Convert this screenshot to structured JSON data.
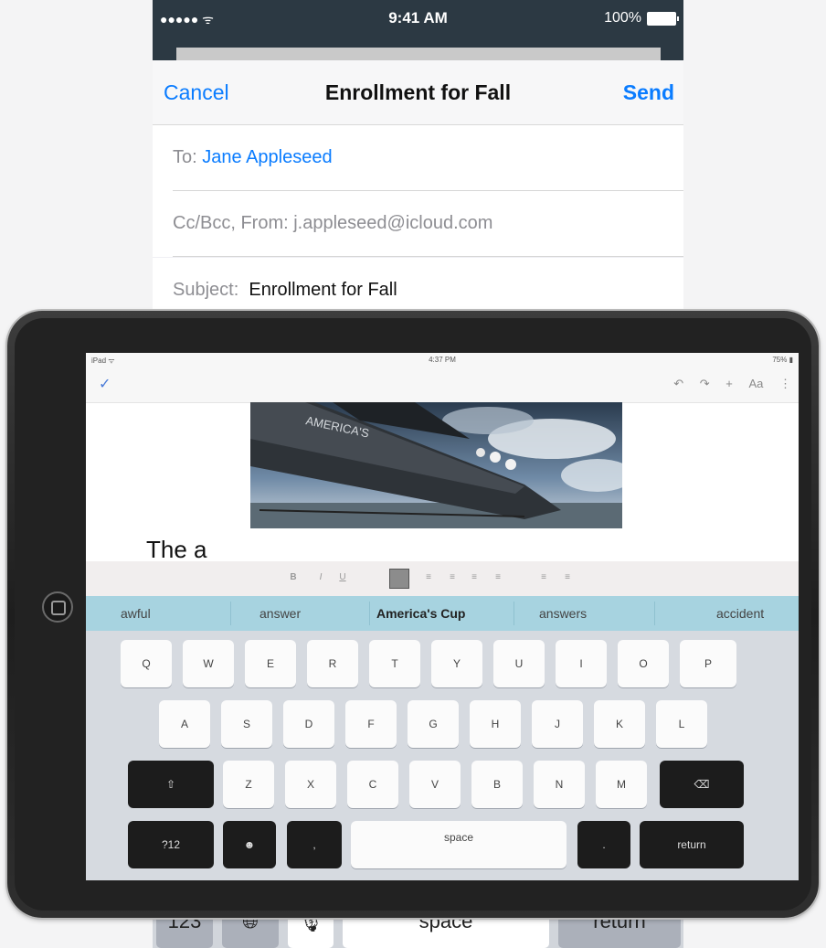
{
  "phone": {
    "status": {
      "signal": "●●●●● ᯤ",
      "time": "9:41 AM",
      "battery": "100%"
    },
    "nav": {
      "cancel": "Cancel",
      "title": "Enrollment for Fall",
      "send": "Send"
    },
    "to": {
      "label": "To:",
      "value": "Jane Appleseed"
    },
    "ccbcc": {
      "label": "Cc/Bcc, From:",
      "value": "j.appleseed@icloud.com"
    },
    "subject": {
      "label": "Subject:",
      "value": "Enrollment for Fall"
    },
    "keyboard_row": {
      "k123": "123",
      "space": "space",
      "return": "return"
    }
  },
  "ipad": {
    "status": {
      "left": "iPad ᯤ",
      "time": "4:37 PM",
      "battery": "75% ▮"
    },
    "toolbar": {
      "check": "✓",
      "tools": [
        "↶",
        "↷",
        "+",
        "Aa",
        "⋮"
      ]
    },
    "document_text": "The a",
    "format_buttons": [
      "B",
      "I",
      "U",
      "",
      "",
      "",
      "",
      "",
      ""
    ],
    "suggestions": [
      "awful",
      "answer",
      "America's Cup",
      "answers",
      "accident"
    ],
    "keyboard": {
      "row1": [
        "Q",
        "W",
        "E",
        "R",
        "T",
        "Y",
        "U",
        "I",
        "O",
        "P"
      ],
      "row2": [
        "A",
        "S",
        "D",
        "F",
        "G",
        "H",
        "J",
        "K",
        "L"
      ],
      "row3": [
        "⇧",
        "Z",
        "X",
        "C",
        "V",
        "B",
        "N",
        "M",
        "⌫"
      ],
      "row4": {
        "num": "?12",
        "emoji": "☻",
        "comma": ",",
        "space": "space",
        "period": ".",
        "return": "return"
      }
    }
  },
  "colors": {
    "ios_blue": "#0a7cff",
    "suggestion_bar": "#a7d3e0",
    "status_dark": "#2c3943"
  }
}
